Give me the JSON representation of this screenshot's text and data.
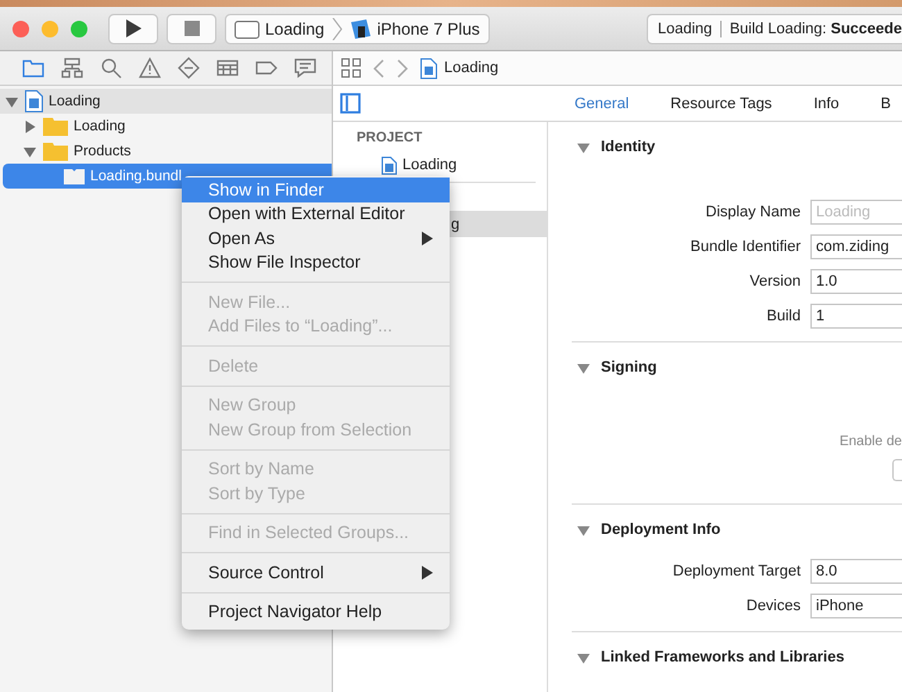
{
  "toolbar": {
    "scheme": "Loading",
    "device": "iPhone 7 Plus",
    "activity_project": "Loading",
    "activity_status": "Build Loading: **Succeede**"
  },
  "navigator_tabs": [
    {
      "selected": true
    },
    {
      "selected": false
    },
    {
      "selected": false
    },
    {
      "selected": false
    },
    {
      "selected": false
    },
    {
      "selected": false
    },
    {
      "selected": false
    },
    {
      "selected": false
    }
  ],
  "tree": [
    {
      "label": "Loading",
      "kind": "project",
      "expanded": true,
      "selected": false,
      "children": [
        {
          "label": "Loading",
          "kind": "folder",
          "expanded": false,
          "selected": false
        },
        {
          "label": "Products",
          "kind": "folder",
          "expanded": true,
          "selected": false,
          "children": [
            {
              "label": "Loading.bundl",
              "kind": "bundle",
              "selected": true
            }
          ]
        }
      ]
    }
  ],
  "jump_bar": {
    "path": "Loading"
  },
  "editor_tabs": [
    {
      "label": "General",
      "selected": true
    },
    {
      "label": "Resource Tags",
      "selected": false
    },
    {
      "label": "Info",
      "selected": false
    },
    {
      "label": "B",
      "selected": false
    }
  ],
  "project_list": {
    "header": "PROJECT",
    "project": {
      "label": "Loading",
      "selected": false
    },
    "target": {
      "label": "g",
      "selected": true
    }
  },
  "sections": [
    {
      "title": "Identity",
      "expanded": true,
      "fields": [
        {
          "label": "Display Name",
          "placeholder": "Loading"
        },
        {
          "label": "Bundle Identifier",
          "value": "com.ziding"
        },
        {
          "label": "Version",
          "value": "1.0"
        },
        {
          "label": "Build",
          "value": "1"
        }
      ]
    },
    {
      "title": "Signing",
      "expanded": true,
      "note": "Enable de"
    },
    {
      "title": "Deployment Info",
      "expanded": true,
      "fields": [
        {
          "label": "Deployment Target",
          "value": "8.0"
        },
        {
          "label": "Devices",
          "value": "iPhone"
        }
      ]
    },
    {
      "title": "Linked Frameworks and Libraries",
      "expanded": true
    }
  ],
  "context_menu": {
    "groups": [
      [
        {
          "label": "Show in Finder",
          "disabled": false,
          "selected": true,
          "submenu": false
        },
        {
          "label": "Open with External Editor",
          "disabled": false,
          "selected": false,
          "submenu": false
        },
        {
          "label": "Open As",
          "disabled": false,
          "selected": false,
          "submenu": true
        },
        {
          "label": "Show File Inspector",
          "disabled": false,
          "selected": false,
          "submenu": false
        }
      ],
      [
        {
          "label": "New File...",
          "disabled": true,
          "selected": false,
          "submenu": false
        },
        {
          "label": "Add Files to “Loading”...",
          "disabled": true,
          "selected": false,
          "submenu": false
        }
      ],
      [
        {
          "label": "Delete",
          "disabled": true,
          "selected": false,
          "submenu": false
        }
      ],
      [
        {
          "label": "New Group",
          "disabled": true,
          "selected": false,
          "submenu": false
        },
        {
          "label": "New Group from Selection",
          "disabled": true,
          "selected": false,
          "submenu": false
        }
      ],
      [
        {
          "label": "Sort by Name",
          "disabled": true,
          "selected": false,
          "submenu": false
        },
        {
          "label": "Sort by Type",
          "disabled": true,
          "selected": false,
          "submenu": false
        }
      ],
      [
        {
          "label": "Find in Selected Groups...",
          "disabled": true,
          "selected": false,
          "submenu": false
        }
      ],
      [
        {
          "label": "Source Control",
          "disabled": false,
          "selected": false,
          "submenu": true
        }
      ],
      [
        {
          "label": "Project Navigator Help",
          "disabled": false,
          "selected": false,
          "submenu": false
        }
      ]
    ]
  }
}
